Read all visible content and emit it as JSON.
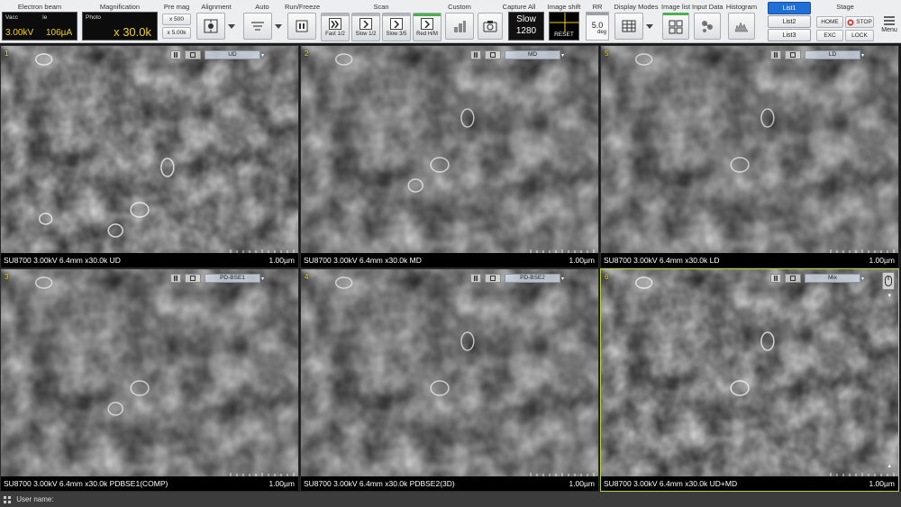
{
  "toolbar": {
    "electron_beam": {
      "label": "Electron beam",
      "vacc_label": "Vacc",
      "ie_label": "Ie",
      "vacc_value": "3.00kV",
      "ie_value": "106µA"
    },
    "magnification": {
      "label": "Magnification",
      "photo_label": "Photo",
      "value": "x 30.0k"
    },
    "pre_mag": {
      "label": "Pre mag",
      "opt1": "x 500",
      "opt2": "x 5.00k"
    },
    "alignment": {
      "label": "Alignment"
    },
    "auto": {
      "label": "Auto"
    },
    "run_freeze": {
      "label": "Run/Freeze"
    },
    "scan": {
      "label": "Scan",
      "buttons": [
        {
          "label": "Fast 1/2",
          "on": false
        },
        {
          "label": "Slow 1/2",
          "on": false
        },
        {
          "label": "Slow 3/5",
          "on": false
        },
        {
          "label": "Red H/M",
          "on": true
        }
      ]
    },
    "custom": {
      "label": "Custom"
    },
    "capture_all": {
      "label": "Capture All",
      "mode": "Slow",
      "value": "1280"
    },
    "image_shift": {
      "label": "Image shift",
      "reset": "RESET"
    },
    "rr": {
      "label": "RR",
      "value": "5.0",
      "unit": "deg"
    },
    "display_modes": {
      "label": "Display Modes"
    },
    "image_list": {
      "label": "Image list"
    },
    "input_data": {
      "label": "Input Data"
    },
    "histogram": {
      "label": "Histogram"
    },
    "lists": [
      "List1",
      "List2",
      "List3"
    ],
    "stage": {
      "label": "Stage",
      "home": "HOME",
      "stop": "STOP",
      "exc": "EXC",
      "lock": "LOCK"
    },
    "menu": "Menu"
  },
  "panels": [
    {
      "num": "1",
      "detector": "UD",
      "info": "SU8700 3.00kV 6.4mm x30.0k UD",
      "scale": "1.00µm"
    },
    {
      "num": "2",
      "detector": "MD",
      "info": "SU8700 3.00kV 6.4mm x30.0k MD",
      "scale": "1.00µm"
    },
    {
      "num": "5",
      "detector": "LD",
      "info": "SU8700 3.00kV 6.4mm x30.0k LD",
      "scale": "1.00µm"
    },
    {
      "num": "3",
      "detector": "PD-BSE1",
      "info": "SU8700 3.00kV 6.4mm x30.0k PDBSE1(COMP)",
      "scale": "1.00µm"
    },
    {
      "num": "4",
      "detector": "PD-BSE2",
      "info": "SU8700 3.00kV 6.4mm x30.0k PDBSE2(3D)",
      "scale": "1.00µm"
    },
    {
      "num": "6",
      "detector": "Mix",
      "info": "SU8700 3.00kV 6.4mm x30.0k UD+MD",
      "scale": "1.00µm"
    }
  ],
  "status": {
    "user_label": "User name:"
  },
  "colors": {
    "accent": "#1f6fd6",
    "readout": "#f2d21a",
    "active_panel": "#b9d33a"
  }
}
